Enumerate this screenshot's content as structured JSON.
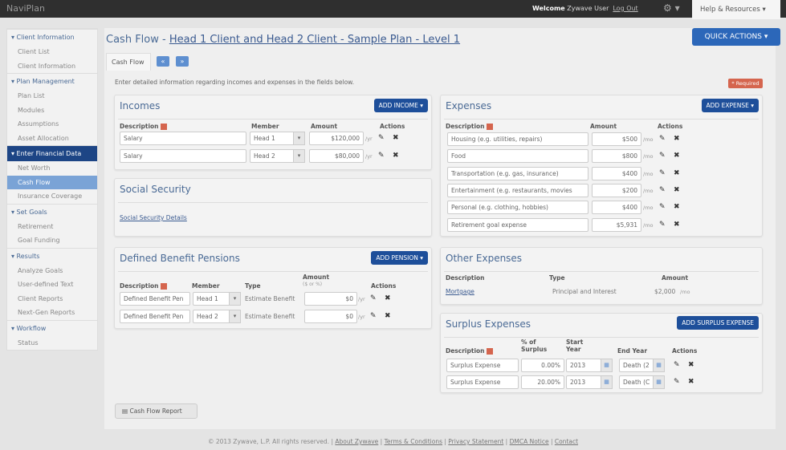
{
  "app": {
    "logo": "NaviPlan",
    "welcome_label": "Welcome",
    "user": "Zywave User",
    "logout": "Log Out",
    "help": "Help & Resources ▾",
    "quick_actions": "QUICK ACTIONS ▾"
  },
  "sidebar": [
    {
      "label": "▾ Client Information",
      "type": "h"
    },
    {
      "label": "Client List",
      "type": "i"
    },
    {
      "label": "Client Information",
      "type": "i"
    },
    {
      "label": "▾ Plan Management",
      "type": "h"
    },
    {
      "label": "Plan List",
      "type": "i"
    },
    {
      "label": "Modules",
      "type": "i"
    },
    {
      "label": "Assumptions",
      "type": "i"
    },
    {
      "label": "Asset Allocation",
      "type": "i"
    },
    {
      "label": "▾ Enter Financial Data",
      "type": "h",
      "active": true
    },
    {
      "label": "Net Worth",
      "type": "i"
    },
    {
      "label": "Cash Flow",
      "type": "i",
      "selected": true
    },
    {
      "label": "Insurance Coverage",
      "type": "i"
    },
    {
      "label": "▾ Set Goals",
      "type": "h"
    },
    {
      "label": "Retirement",
      "type": "i"
    },
    {
      "label": "Goal Funding",
      "type": "i"
    },
    {
      "label": "▾ Results",
      "type": "h"
    },
    {
      "label": "Analyze Goals",
      "type": "i"
    },
    {
      "label": "User-defined Text",
      "type": "i"
    },
    {
      "label": "Client Reports",
      "type": "i"
    },
    {
      "label": "Next-Gen Reports",
      "type": "i"
    },
    {
      "label": "▾ Workflow",
      "type": "h"
    },
    {
      "label": "Status",
      "type": "i"
    }
  ],
  "header": {
    "title_prefix": "Cash Flow - ",
    "title_link": "Head 1 Client and Head 2 Client - Sample Plan - Level 1",
    "tab": "Cash Flow",
    "prev": "«",
    "next": "»",
    "description": "Enter detailed information regarding incomes and expenses in the fields below.",
    "required": "* Required"
  },
  "incomes": {
    "title": "Incomes",
    "add": "ADD INCOME ▾",
    "cols": [
      "Description",
      "Member",
      "Amount",
      "Actions"
    ],
    "unit": "/yr",
    "rows": [
      {
        "desc": "Salary",
        "member": "Head 1",
        "amount": "$120,000"
      },
      {
        "desc": "Salary",
        "member": "Head 2",
        "amount": "$80,000"
      }
    ]
  },
  "social_security": {
    "title": "Social Security",
    "link": "Social Security Details"
  },
  "pensions": {
    "title": "Defined Benefit Pensions",
    "add": "ADD PENSION ▾",
    "cols": [
      "Description",
      "Member",
      "Type",
      "Amount",
      "($ or %)",
      "Actions"
    ],
    "unit": "/yr",
    "rows": [
      {
        "desc": "Defined Benefit Pen",
        "member": "Head 1",
        "type": "Estimate Benefit",
        "amount": "$0"
      },
      {
        "desc": "Defined Benefit Pen",
        "member": "Head 2",
        "type": "Estimate Benefit",
        "amount": "$0"
      }
    ]
  },
  "expenses": {
    "title": "Expenses",
    "add": "ADD EXPENSE ▾",
    "cols": [
      "Description",
      "Amount",
      "Actions"
    ],
    "unit": "/mo",
    "rows": [
      {
        "desc": "Housing (e.g. utilities, repairs)",
        "amount": "$500"
      },
      {
        "desc": "Food",
        "amount": "$800"
      },
      {
        "desc": "Transportation (e.g. gas, insurance)",
        "amount": "$400"
      },
      {
        "desc": "Entertainment (e.g. restaurants, movies",
        "amount": "$200"
      },
      {
        "desc": "Personal (e.g. clothing, hobbies)",
        "amount": "$400"
      },
      {
        "desc": "Retirement goal expense",
        "amount": "$5,931"
      }
    ]
  },
  "other_expenses": {
    "title": "Other Expenses",
    "cols": [
      "Description",
      "Type",
      "Amount"
    ],
    "rows": [
      {
        "desc": "Mortgage",
        "type": "Principal and Interest",
        "amount": "$2,000",
        "unit": "/mo"
      }
    ]
  },
  "surplus": {
    "title": "Surplus Expenses",
    "add": "ADD SURPLUS EXPENSE",
    "cols": [
      "Description",
      "% of Surplus",
      "Start Year",
      "End Year",
      "Actions"
    ],
    "rows": [
      {
        "desc": "Surplus Expense",
        "pct": "0.00%",
        "start": "2013",
        "end": "Death (2"
      },
      {
        "desc": "Surplus Expense",
        "pct": "20.00%",
        "start": "2013",
        "end": "Death (C"
      }
    ]
  },
  "report_button": "Cash Flow Report",
  "footer": {
    "copyright": "© 2013 Zywave, L.P. All rights reserved.",
    "links": [
      "About Zywave",
      "Terms & Conditions",
      "Privacy Statement",
      "DMCA Notice",
      "Contact"
    ]
  },
  "colors": {
    "accent": "#1e4f9a",
    "active_nav": "#1d4585",
    "selected_nav": "#7aa3d6",
    "required": "#d5654e"
  }
}
